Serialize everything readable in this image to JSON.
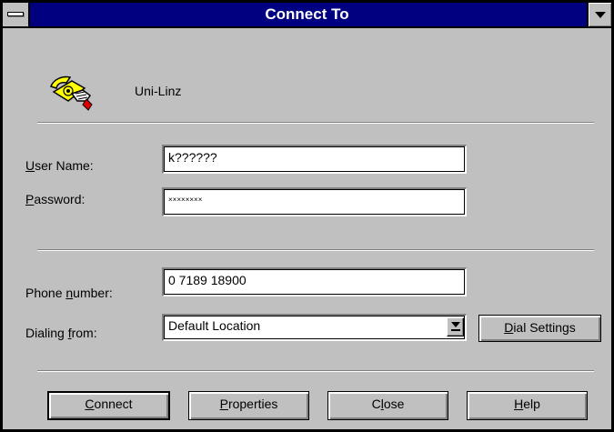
{
  "window": {
    "title": "Connect To"
  },
  "connection": {
    "name": "Uni-Linz",
    "icon": "telephone-icon"
  },
  "fields": {
    "username": {
      "label_underline": "U",
      "label_rest": "ser Name:",
      "value": "k??????"
    },
    "password": {
      "label_underline": "P",
      "label_rest": "assword:",
      "value": "××××××××"
    },
    "phone": {
      "label_pre": "Phone ",
      "label_underline": "n",
      "label_rest": "umber:",
      "value": "0 7189 18900"
    },
    "dialing": {
      "label_pre": "Dialing ",
      "label_underline": "f",
      "label_rest": "rom:",
      "value": "Default Location"
    }
  },
  "buttons": {
    "dial_settings": {
      "underline": "D",
      "rest": "ial Settings"
    },
    "connect": {
      "underline": "C",
      "rest": "onnect"
    },
    "properties": {
      "pre": "",
      "underline": "P",
      "rest": "roperties"
    },
    "close": {
      "pre": "C",
      "underline": "l",
      "rest": "ose"
    },
    "help": {
      "underline": "H",
      "rest": "elp"
    }
  },
  "colors": {
    "titlebar": "#000080",
    "face": "#c0c0c0"
  }
}
